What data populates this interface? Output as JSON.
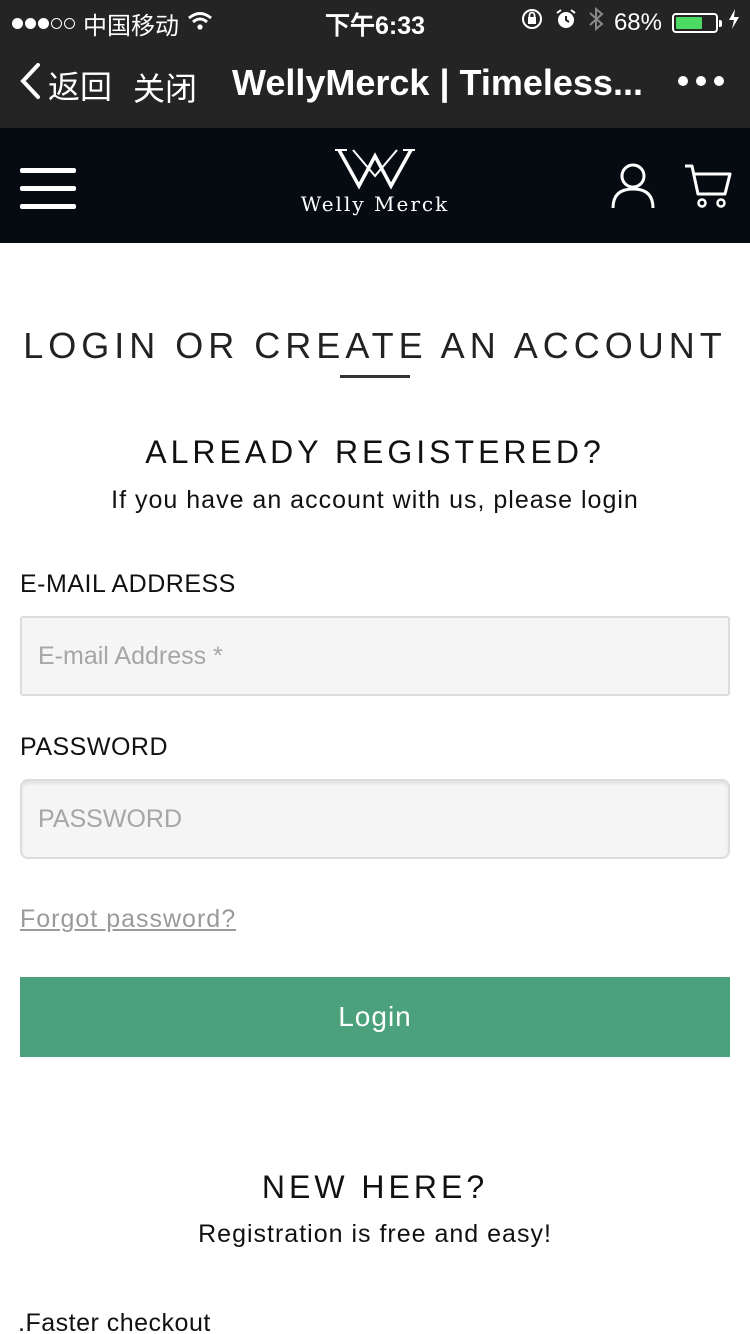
{
  "status_bar": {
    "carrier": "中国移动",
    "time": "下午6:33",
    "battery_percent": "68%",
    "battery_level": 0.68,
    "battery_color": "#4cd964",
    "icons": [
      "signal-dots-icon",
      "wifi-icon",
      "orientation-lock-icon",
      "alarm-icon",
      "bluetooth-icon",
      "battery-icon",
      "charging-icon"
    ]
  },
  "nav_bar": {
    "back_label": "返回",
    "close_label": "关闭",
    "title": "WellyMerck | Timeless...",
    "icons": [
      "chevron-left-icon",
      "more-icon"
    ]
  },
  "site_header": {
    "logo_text": "Welly Merck",
    "icons": [
      "hamburger-menu-icon",
      "user-icon",
      "cart-icon"
    ]
  },
  "main": {
    "page_title": "LOGIN OR CREATE AN ACCOUNT",
    "registered": {
      "title": "ALREADY REGISTERED?",
      "subtitle": "If you have an account with us, please login"
    },
    "email": {
      "label": "E-MAIL ADDRESS",
      "placeholder": "E-mail Address *",
      "value": ""
    },
    "password": {
      "label": "PASSWORD",
      "placeholder": "PASSWORD",
      "value": ""
    },
    "forgot_link": "Forgot password?",
    "login_button": "Login",
    "login_button_color": "#4aa17b",
    "new_here": {
      "title": "NEW HERE?",
      "subtitle": "Registration is free and easy!"
    },
    "benefits": [
      ".Faster checkout"
    ]
  }
}
